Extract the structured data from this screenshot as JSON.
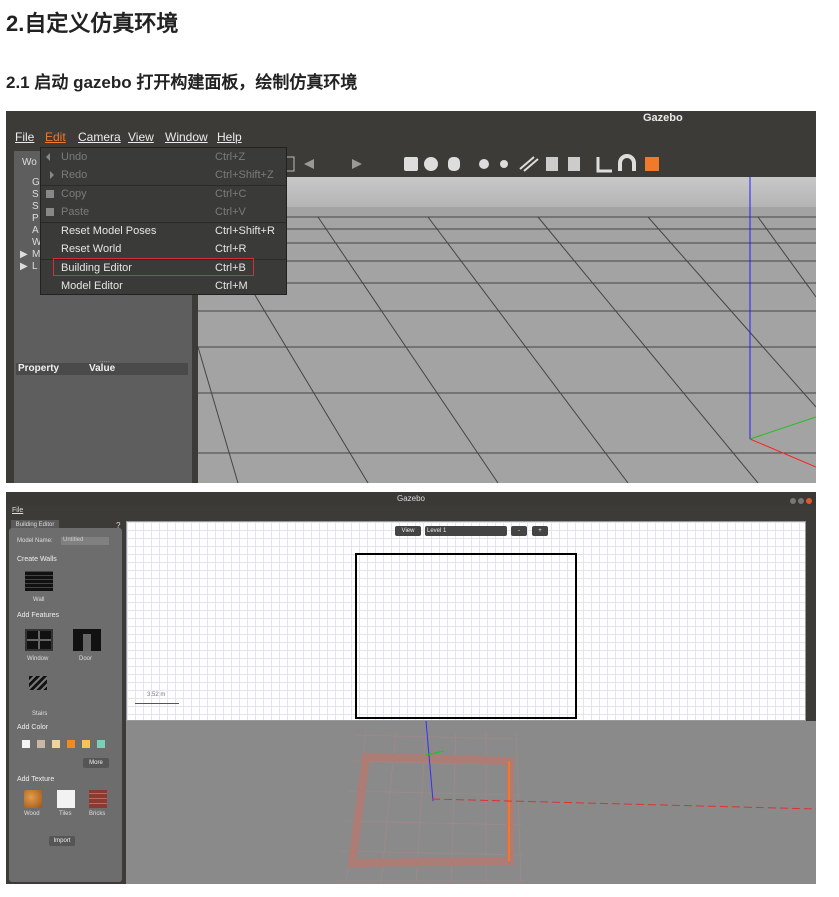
{
  "headings": {
    "h2": "2.自定义仿真环境",
    "h3": "2.1 启动 gazebo 打开构建面板，绘制仿真环境"
  },
  "shot1": {
    "title": "Gazebo",
    "menubar": [
      "File",
      "Edit",
      "Camera",
      "View",
      "Window",
      "Help"
    ],
    "active_menu": "Edit",
    "left_tree": [
      "Wo",
      "G",
      "S",
      "S",
      "P",
      "A",
      "W",
      "M",
      "L"
    ],
    "prop_headers": {
      "property": "Property",
      "value": "Value"
    },
    "edit_menu": [
      {
        "label": "Undo",
        "shortcut": "Ctrl+Z",
        "disabled": true,
        "icon": "undo-icon"
      },
      {
        "label": "Redo",
        "shortcut": "Ctrl+Shift+Z",
        "disabled": true,
        "icon": "redo-icon"
      },
      {
        "label": "Copy",
        "shortcut": "Ctrl+C",
        "disabled": true,
        "icon": "copy-icon"
      },
      {
        "label": "Paste",
        "shortcut": "Ctrl+V",
        "disabled": true,
        "icon": "paste-icon"
      },
      {
        "label": "Reset Model Poses",
        "shortcut": "Ctrl+Shift+R",
        "disabled": false
      },
      {
        "label": "Reset World",
        "shortcut": "Ctrl+R",
        "disabled": false
      },
      {
        "label": "Building Editor",
        "shortcut": "Ctrl+B",
        "disabled": false,
        "highlighted": true
      },
      {
        "label": "Model Editor",
        "shortcut": "Ctrl+M",
        "disabled": false
      }
    ],
    "accent": "#f07a2a",
    "highlight_color": "#d0303a"
  },
  "shot2": {
    "title": "Gazebo",
    "menu_file": "File",
    "tab": "Building Editor",
    "help": "?",
    "model_name_label": "Model Name:",
    "model_name_value": "Untitled",
    "create_walls": "Create Walls",
    "wall": "Wall",
    "add_features": "Add Features",
    "window": "Window",
    "door": "Door",
    "stairs": "Stairs",
    "add_color": "Add Color",
    "colors": [
      "#f4f4f4",
      "#c8b8a4",
      "#ecd49c",
      "#f28a1e",
      "#f6c35a",
      "#7ccfb6"
    ],
    "more": "More",
    "add_texture": "Add Texture",
    "wood": "Wood",
    "tiles": "Tiles",
    "bricks": "Bricks",
    "import": "Import",
    "view_btn": "View",
    "level": "Level 1",
    "minus": "-",
    "plus": "+",
    "scale": "3.52 m"
  }
}
